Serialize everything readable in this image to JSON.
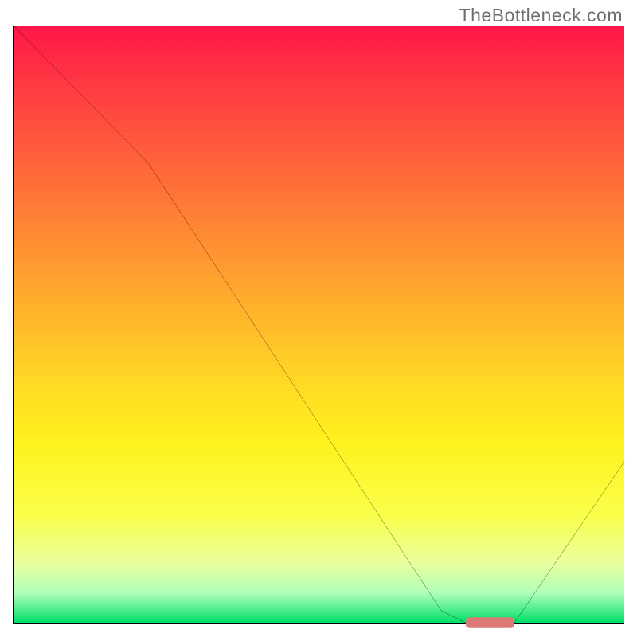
{
  "watermark": "TheBottleneck.com",
  "chart_data": {
    "type": "line",
    "title": "",
    "xlabel": "",
    "ylabel": "",
    "xlim": [
      0,
      100
    ],
    "ylim": [
      0,
      100
    ],
    "curve": [
      {
        "x": 0,
        "y": 100
      },
      {
        "x": 22,
        "y": 77
      },
      {
        "x": 70,
        "y": 2
      },
      {
        "x": 74,
        "y": 0
      },
      {
        "x": 82,
        "y": 0
      },
      {
        "x": 100,
        "y": 27
      }
    ],
    "optimal_range": {
      "x_start": 74,
      "x_end": 82,
      "y": 0
    },
    "marker_color": "#dd7a77",
    "gradient": {
      "top": "#ff1648",
      "bottom": "#00e068"
    }
  }
}
